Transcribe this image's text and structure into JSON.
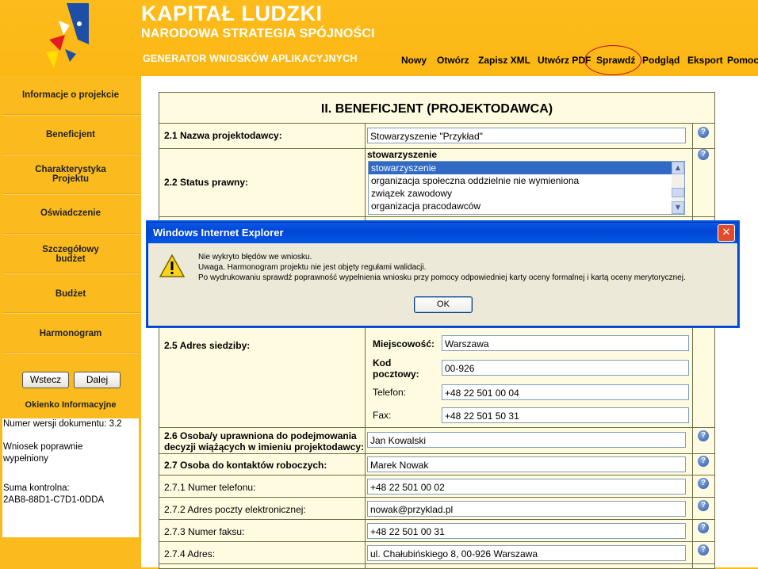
{
  "header": {
    "brand_line1": "KAPITAŁ LUDZKI",
    "brand_line2": "NARODOWA STRATEGIA SPÓJNOŚCI",
    "brand_line3": "GENERATOR WNIOSKÓW APLIKACYJNYCH",
    "menu": [
      "Nowy",
      "Otwórz",
      "Zapisz XML",
      "Utwórz PDF",
      "Sprawdź",
      "Podgląd",
      "Eksport",
      "Pomoc"
    ]
  },
  "sidebar": {
    "items": [
      {
        "label": "Informacje o projekcie"
      },
      {
        "label": "Beneficjent"
      },
      {
        "label": "Charakterystyka",
        "label2": "Projektu"
      },
      {
        "label": "Oświadczenie"
      },
      {
        "label": "Szczegółowy",
        "label2": "budżet"
      },
      {
        "label": "Budżet"
      },
      {
        "label": "Harmonogram"
      }
    ],
    "back_label": "Wstecz",
    "next_label": "Dalej",
    "info_title": "Okienko Informacyjne",
    "info_lines": [
      "Numer wersji dokumentu: 3.2",
      "Wniosek poprawnie",
      "wypełniony",
      "Suma kontrolna:",
      "2AB8-88D1-C7D1-0DDA"
    ]
  },
  "form": {
    "title": "II. BENEFICJENT (PROJEKTODAWCA)",
    "f21_label": "2.1 Nazwa projektodawcy:",
    "f21_value": "Stowarzyszenie \"Przykład\"",
    "f22_label": "2.2 Status prawny:",
    "f22_current": "stowarzyszenie",
    "f22_options": [
      "stowarzyszenie",
      "organizacja społeczna oddzielnie nie wymieniona",
      "związek zawodowy",
      "organizacja pracodawców"
    ],
    "f25_label": "2.5 Adres siedziby:",
    "city_label": "Miejscowość:",
    "city_value": "Warszawa",
    "postal_label1": "Kod",
    "postal_label2": "pocztowy:",
    "postal_value": "00-926",
    "phone_label": "Telefon:",
    "phone_value": "+48 22 501 00 04",
    "fax_label": "Fax:",
    "fax_value": "+48 22 501 50 31",
    "f26_label1": "2.6 Osoba/y uprawniona do podejmowania",
    "f26_label2": "decyzji wiążących w imieniu projektodawcy:",
    "f26_value": "Jan Kowalski",
    "f27_label": "2.7 Osoba do kontaktów roboczych:",
    "f27_value": "Marek Nowak",
    "f271_label": "2.7.1 Numer telefonu:",
    "f271_value": "+48 22 501 00 02",
    "f272_label": "2.7.2 Adres poczty elektronicznej:",
    "f272_value": "nowak@przyklad.pl",
    "f273_label": "2.7.3 Numer faksu:",
    "f273_value": "+48 22 501 00 31",
    "f274_label": "2.7.4 Adres:",
    "f274_value": "ul. Chałubińskiego 8, 00-926 Warszawa",
    "help_glyph": "?"
  },
  "dialog": {
    "title": "Windows Internet Explorer",
    "close_glyph": "✕",
    "line1": "Nie wykryto błędów we wniosku.",
    "line2": "Uwaga. Harmonogram projektu nie jest objęty regułami walidacji.",
    "line3": "Po wydrukowaniu sprawdź poprawność wypełnienia wniosku przy pomocy odpowiedniej karty oceny formalnej i kartą oceny merytorycznej.",
    "ok_label": "OK"
  },
  "colors": {
    "accent": "#fbbb1e",
    "form_bg": "#fffbe0",
    "titlebar": "#0054e3"
  }
}
